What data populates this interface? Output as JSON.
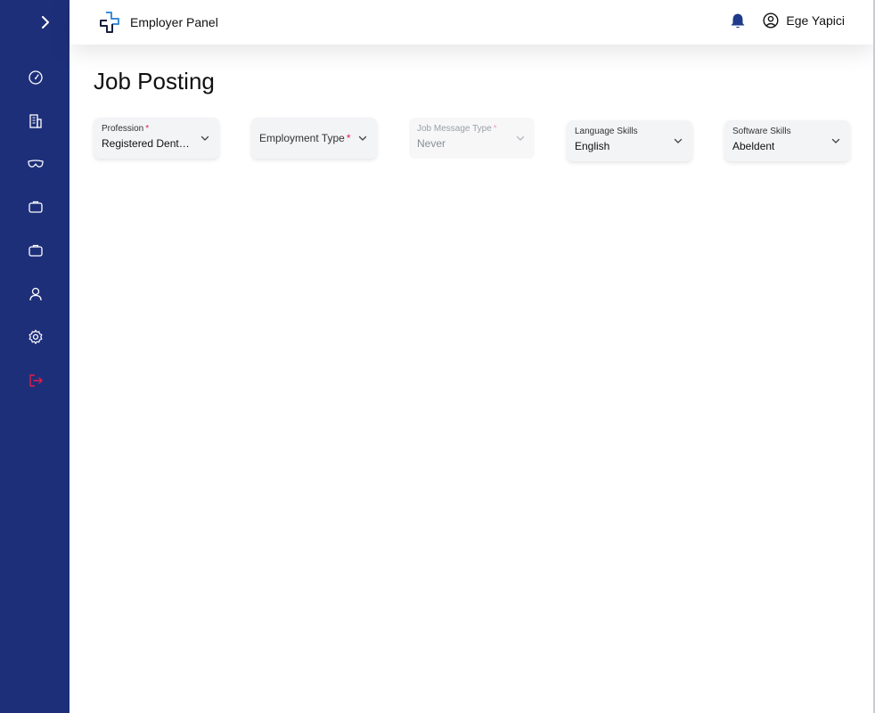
{
  "app": {
    "title": "Employer Panel"
  },
  "user": {
    "name": "Ege Yapici"
  },
  "page": {
    "title": "Job Posting"
  },
  "sidebar": {
    "items": [
      {
        "icon": "dashboard-icon"
      },
      {
        "icon": "building-icon"
      },
      {
        "icon": "glasses-icon"
      },
      {
        "icon": "briefcase-icon"
      },
      {
        "icon": "briefcase-alt-icon"
      },
      {
        "icon": "user-icon"
      },
      {
        "icon": "gear-icon"
      },
      {
        "icon": "logout-icon"
      }
    ]
  },
  "filters": {
    "profession": {
      "label": "Profession",
      "required_mark": "*",
      "value": "Registered Dental Hygienist"
    },
    "employment_type": {
      "label": "Employment Type",
      "required_mark": "*"
    },
    "job_message_type": {
      "label": "Job Message Type",
      "required_mark": "*",
      "value": "Never",
      "disabled": true
    },
    "language_skills": {
      "label": "Language Skills",
      "value": "English"
    },
    "software_skills": {
      "label": "Software Skills",
      "value": "Abeldent"
    }
  },
  "colors": {
    "sidebar_bg": "#1e2f7a",
    "accent": "#1e3a8a",
    "logout": "#e11d48",
    "required": "#e11d48"
  }
}
